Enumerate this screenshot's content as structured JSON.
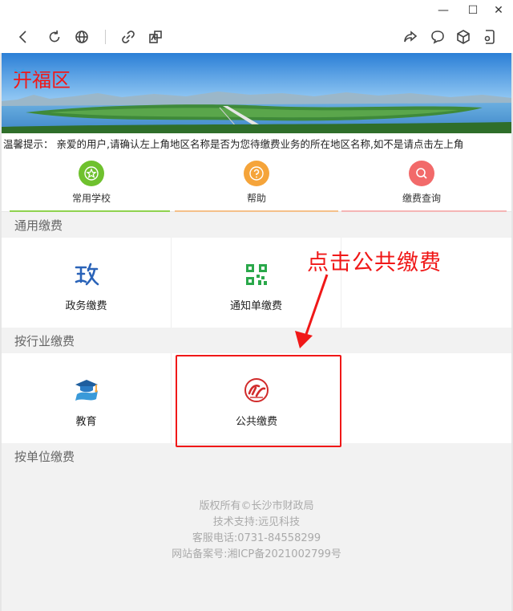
{
  "window": {
    "minimize_glyph": "—",
    "maximize_glyph": "☐",
    "close_glyph": "✕"
  },
  "toolbar": {
    "icons": [
      "back-icon",
      "refresh-icon",
      "globe-icon",
      "link-icon",
      "translate-icon",
      "share-icon",
      "comment-icon",
      "cube-icon",
      "miniprogram-icon"
    ]
  },
  "banner": {
    "region_name": "开福区"
  },
  "notice": {
    "text": "温馨提示：  亲爱的用户,请确认左上角地区名称是否为您待缴费业务的所在地区名称,如不是请点击左上角"
  },
  "quick_links": [
    {
      "label": "常用学校",
      "icon": "star-icon",
      "color": "#6fc12e",
      "line": "#8fd24f"
    },
    {
      "label": "帮助",
      "icon": "question-icon",
      "color": "#f5a43a",
      "line": "#f5c08a"
    },
    {
      "label": "缴费查询",
      "icon": "search-icon",
      "color": "#f26a6a",
      "line": "#f5b5b5"
    }
  ],
  "sections": {
    "general": {
      "title": "通用缴费",
      "items": [
        {
          "label": "政务缴费",
          "icon": "government-icon"
        },
        {
          "label": "通知单缴费",
          "icon": "qr-notice-icon"
        }
      ]
    },
    "industry": {
      "title": "按行业缴费",
      "items": [
        {
          "label": "教育",
          "icon": "graduation-icon"
        },
        {
          "label": "公共缴费",
          "icon": "public-payment-icon"
        }
      ]
    },
    "unit": {
      "title": "按单位缴费"
    }
  },
  "footer": {
    "copyright": "版权所有©长沙市财政局",
    "support": "技术支持:远见科技",
    "phone": "客服电话:0731-84558299",
    "icp": "网站备案号:湘ICP备2021002799号"
  },
  "annotation": {
    "text": "点击公共缴费",
    "color": "#f01818"
  }
}
